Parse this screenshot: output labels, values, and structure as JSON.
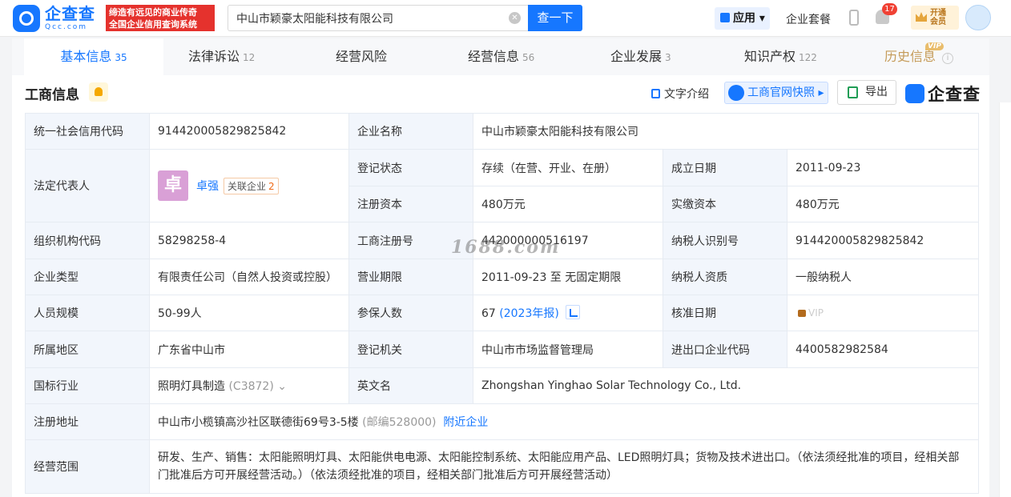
{
  "header": {
    "logo_cn": "企查查",
    "logo_en": "Qcc.com",
    "slogan_line1": "缔造有远见的商业传奇",
    "slogan_line2": "全国企业信用查询系统",
    "search_value": "中山市颖豪太阳能科技有限公司",
    "search_button": "查一下",
    "apps_label": "应用",
    "suite_label": "企业套餐",
    "notification_count": "17",
    "vip_line1": "开通",
    "vip_line2": "会员"
  },
  "tabs": [
    {
      "label": "基本信息",
      "count": "35"
    },
    {
      "label": "法律诉讼",
      "count": "12"
    },
    {
      "label": "经营风险",
      "count": ""
    },
    {
      "label": "经营信息",
      "count": "56"
    },
    {
      "label": "企业发展",
      "count": "3"
    },
    {
      "label": "知识产权",
      "count": "122"
    },
    {
      "label": "历史信息",
      "count": ""
    }
  ],
  "vip_tag": "VIP",
  "section": {
    "title": "工商信息",
    "text_intro": "文字介绍",
    "snapshot": "工商官网快照",
    "export": "导出",
    "brand": "企查查"
  },
  "company": {
    "credit_code_label": "统一社会信用代码",
    "credit_code": "914420005829825842",
    "name_label": "企业名称",
    "name": "中山市颖豪太阳能科技有限公司",
    "legal_rep_label": "法定代表人",
    "legal_rep_avatar": "卓",
    "legal_rep_name": "卓强",
    "related_label": "关联企业",
    "related_count": "2",
    "reg_status_label": "登记状态",
    "reg_status": "存续（在营、开业、在册）",
    "founded_label": "成立日期",
    "founded": "2011-09-23",
    "reg_capital_label": "注册资本",
    "reg_capital": "480万元",
    "paid_capital_label": "实缴资本",
    "paid_capital": "480万元",
    "org_code_label": "组织机构代码",
    "org_code": "58298258-4",
    "reg_no_label": "工商注册号",
    "reg_no": "442000000516197",
    "taxpayer_id_label": "纳税人识别号",
    "taxpayer_id": "914420005829825842",
    "type_label": "企业类型",
    "type": "有限责任公司（自然人投资或控股）",
    "term_label": "营业期限",
    "term": "2011-09-23 至 无固定期限",
    "taxpayer_qual_label": "纳税人资质",
    "taxpayer_qual": "一般纳税人",
    "staff_label": "人员规模",
    "staff": "50-99人",
    "insured_label": "参保人数",
    "insured": "67",
    "insured_year": "(2023年报)",
    "approval_label": "核准日期",
    "approval_left": "",
    "approval_right": "VIP",
    "region_label": "所属地区",
    "region": "广东省中山市",
    "authority_label": "登记机关",
    "authority": "中山市市场监督管理局",
    "import_export_label": "进出口企业代码",
    "import_export": "4400582982584",
    "industry_label": "国标行业",
    "industry": "照明灯具制造",
    "industry_code": "(C3872)",
    "english_label": "英文名",
    "english": "Zhongshan Yinghao Solar Technology Co., Ltd.",
    "address_label": "注册地址",
    "address": "中山市小榄镇高沙社区联德街69号3-5楼",
    "postcode": "(邮编528000)",
    "nearby": "附近企业",
    "scope_label": "经营范围",
    "scope": "研发、生产、销售：太阳能照明灯具、太阳能供电电源、太阳能控制系统、太阳能应用产品、LED照明灯具；货物及技术进出口。（依法须经批准的项目，经相关部门批准后方可开展经营活动。）（依法须经批准的项目，经相关部门批准后方可开展经营活动）"
  },
  "watermark": "1688.com",
  "colors": {
    "brand_blue": "#1677ff",
    "slogan_red": "#e5322d",
    "label_bg": "#f2f6fc"
  }
}
